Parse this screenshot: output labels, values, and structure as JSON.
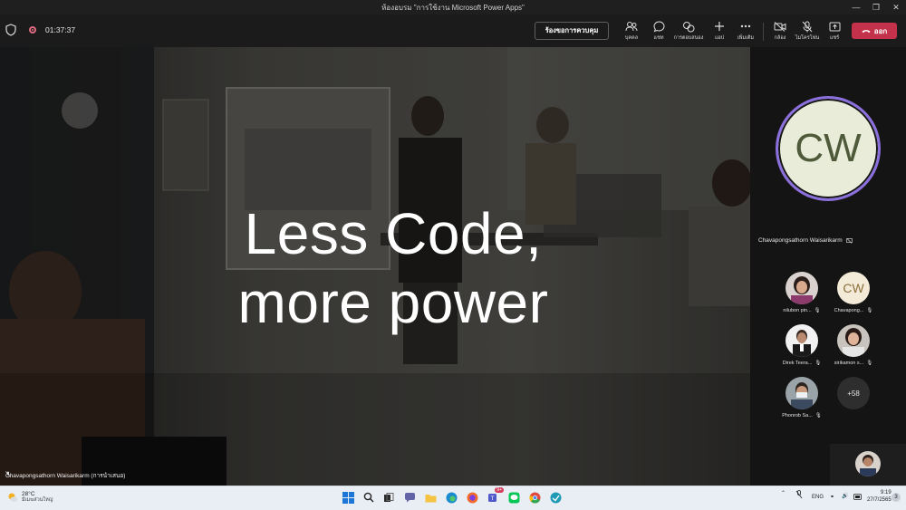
{
  "window": {
    "title": "ห้องอบรม \"การใช้งาน Microsoft Power Apps\""
  },
  "toolbar": {
    "timer": "01:37:37",
    "request_label": "ร้องขอการควบคุม",
    "tools": [
      {
        "label": "บุคคล",
        "icon": "people-icon"
      },
      {
        "label": "แชท",
        "icon": "chat-icon"
      },
      {
        "label": "การตอบสนอง",
        "icon": "reactions-icon"
      },
      {
        "label": "แอป",
        "icon": "plus-icon"
      },
      {
        "label": "เพิ่มเติม",
        "icon": "more-icon"
      },
      {
        "label": "กล้อง",
        "icon": "camera-off-icon"
      },
      {
        "label": "ไมโครโฟน",
        "icon": "mic-off-icon"
      },
      {
        "label": "แชร์",
        "icon": "share-icon"
      }
    ],
    "leave_label": "ออก",
    "leave_color": "#c4314b"
  },
  "slide": {
    "line1": "Less Code,",
    "line2": "more power",
    "presenter": "Chavapongsathorn Waisarikarm (การนำเสนอ)"
  },
  "panel": {
    "spotlight": {
      "initials": "CW",
      "name": "Chavapongsathorn Waisarikarm",
      "ring_color": "#8b6fdc"
    },
    "participants": [
      {
        "name": "nilubon pin...",
        "type": "photo"
      },
      {
        "name": "Chavapong...",
        "type": "initials",
        "initials": "CW"
      },
      {
        "name": "Direk Teera...",
        "type": "photo"
      },
      {
        "name": "sirikamon s...",
        "type": "photo"
      },
      {
        "name": "Phonrob Sa...",
        "type": "photo"
      }
    ],
    "overflow_count": "+58"
  },
  "taskbar": {
    "weather_temp": "28°C",
    "weather_desc": "มีเมฆส่วนใหญ่",
    "teams_badge": "9+",
    "lang": "ENG",
    "time": "9:19",
    "date": "27/7/2565",
    "notif_count": "3"
  }
}
